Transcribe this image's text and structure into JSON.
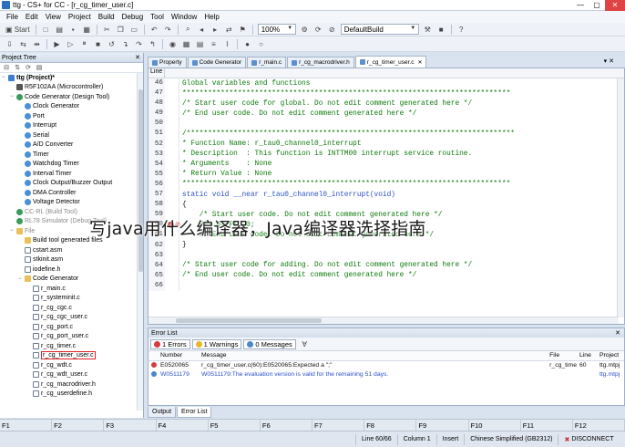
{
  "window": {
    "title": "ttg - CS+ for CC - [r_cg_timer_user.c]"
  },
  "menu": [
    "File",
    "Edit",
    "View",
    "Project",
    "Build",
    "Debug",
    "Tool",
    "Window",
    "Help"
  ],
  "toolbar1": {
    "start_label": "Start",
    "zoom": "100%",
    "build_mode": "DefaultBuild"
  },
  "project_tree": {
    "header": "Project Tree",
    "items": [
      {
        "label": "ttg (Project)*",
        "indent": 0,
        "icon": "proj",
        "exp": "▣",
        "bold": true
      },
      {
        "label": "R5F102AA (Microcontroller)",
        "indent": 1,
        "icon": "chip"
      },
      {
        "label": "Code Generator (Design Tool)",
        "indent": 1,
        "icon": "gear",
        "exp": "▣"
      },
      {
        "label": "Clock Generator",
        "indent": 2,
        "icon": "blue"
      },
      {
        "label": "Port",
        "indent": 2,
        "icon": "blue"
      },
      {
        "label": "Interrupt",
        "indent": 2,
        "icon": "blue"
      },
      {
        "label": "Serial",
        "indent": 2,
        "icon": "blue"
      },
      {
        "label": "A/D Converter",
        "indent": 2,
        "icon": "blue"
      },
      {
        "label": "Timer",
        "indent": 2,
        "icon": "blue"
      },
      {
        "label": "Watchdog Timer",
        "indent": 2,
        "icon": "blue"
      },
      {
        "label": "Interval Timer",
        "indent": 2,
        "icon": "blue"
      },
      {
        "label": "Clock Output/Buzzer Output",
        "indent": 2,
        "icon": "blue"
      },
      {
        "label": "DMA Controller",
        "indent": 2,
        "icon": "blue"
      },
      {
        "label": "Voltage Detector",
        "indent": 2,
        "icon": "blue"
      },
      {
        "label": "CC-RL (Build Tool)",
        "indent": 1,
        "icon": "gear",
        "faded": true
      },
      {
        "label": "RL78 Simulator (Debug Tool)",
        "indent": 1,
        "icon": "gear",
        "faded": true
      },
      {
        "label": "File",
        "indent": 1,
        "icon": "fold",
        "exp": "▣",
        "faded": true
      },
      {
        "label": "Build tool generated files",
        "indent": 2,
        "icon": "fold"
      },
      {
        "label": "cstart.asm",
        "indent": 2,
        "icon": "file"
      },
      {
        "label": "stkinit.asm",
        "indent": 2,
        "icon": "file"
      },
      {
        "label": "iodefine.h",
        "indent": 2,
        "icon": "file"
      },
      {
        "label": "Code Generator",
        "indent": 2,
        "icon": "fold",
        "exp": "▣"
      },
      {
        "label": "r_main.c",
        "indent": 3,
        "icon": "file"
      },
      {
        "label": "r_systeminit.c",
        "indent": 3,
        "icon": "file"
      },
      {
        "label": "r_cg_cgc.c",
        "indent": 3,
        "icon": "file"
      },
      {
        "label": "r_cg_cgc_user.c",
        "indent": 3,
        "icon": "file"
      },
      {
        "label": "r_cg_port.c",
        "indent": 3,
        "icon": "file"
      },
      {
        "label": "r_cg_port_user.c",
        "indent": 3,
        "icon": "file"
      },
      {
        "label": "r_cg_timer.c",
        "indent": 3,
        "icon": "file"
      },
      {
        "label": "r_cg_timer_user.c",
        "indent": 3,
        "icon": "file",
        "selected": true
      },
      {
        "label": "r_cg_wdt.c",
        "indent": 3,
        "icon": "file"
      },
      {
        "label": "r_cg_wdt_user.c",
        "indent": 3,
        "icon": "file"
      },
      {
        "label": "r_cg_macrodriver.h",
        "indent": 3,
        "icon": "file"
      },
      {
        "label": "r_cg_userdefine.h",
        "indent": 3,
        "icon": "file"
      }
    ]
  },
  "editor_tabs": [
    {
      "label": "Property",
      "active": false
    },
    {
      "label": "Code Generator",
      "active": false
    },
    {
      "label": "r_main.c",
      "active": false
    },
    {
      "label": "r_cg_macrodriver.h",
      "active": false
    },
    {
      "label": "r_cg_timer_user.c",
      "active": true
    }
  ],
  "editor": {
    "line_header": "Line",
    "lines": [
      {
        "n": "46",
        "text": "Global variables and functions",
        "kind": "comment"
      },
      {
        "n": "47",
        "text": "*****************************************************************************",
        "kind": "comment"
      },
      {
        "n": "48",
        "text": "/* Start user code for global. Do not edit comment generated here */",
        "kind": "comment"
      },
      {
        "n": "49",
        "text": "/* End user code. Do not edit comment generated here */",
        "kind": "comment"
      },
      {
        "n": "50",
        "text": "",
        "kind": "comment"
      },
      {
        "n": "51",
        "text": "/*****************************************************************************",
        "kind": "comment"
      },
      {
        "n": "52",
        "text": "* Function Name: r_tau0_channel0_interrupt",
        "kind": "comment"
      },
      {
        "n": "53",
        "text": "* Description  : This function is INTTM00 interrupt service routine.",
        "kind": "comment"
      },
      {
        "n": "54",
        "text": "* Arguments    : None",
        "kind": "comment"
      },
      {
        "n": "55",
        "text": "* Return Value : None",
        "kind": "comment"
      },
      {
        "n": "56",
        "text": "*****************************************************************************",
        "kind": "comment"
      },
      {
        "n": "57",
        "text": "static void __near r_tau0_channel0_interrupt(void)",
        "kind": "kw"
      },
      {
        "n": "58",
        "text": "{",
        "kind": "plain"
      },
      {
        "n": "59",
        "text": "    /* Start user code. Do not edit comment generated here */",
        "kind": "comment"
      },
      {
        "n": "60",
        "text": "    P13.0=~P13.0;",
        "kind": "comment",
        "breakpoint": true
      },
      {
        "n": "61",
        "text": "    /* End user code. Do not edit comment generated here */",
        "kind": "comment"
      },
      {
        "n": "62",
        "text": "}",
        "kind": "plain"
      },
      {
        "n": "63",
        "text": "",
        "kind": "plain"
      },
      {
        "n": "64",
        "text": "/* Start user code for adding. Do not edit comment generated here */",
        "kind": "comment"
      },
      {
        "n": "65",
        "text": "/* End user code. Do not edit comment generated here */",
        "kind": "comment"
      },
      {
        "n": "66",
        "text": "",
        "kind": "plain"
      }
    ]
  },
  "watermark": "写java用什么编译器，Java编译器选择指南",
  "error_list": {
    "header": "Error List",
    "filters": {
      "errors": "1 Errors",
      "warnings": "1 Warnings",
      "messages": "0 Messages"
    },
    "columns": [
      "",
      "Number",
      "Message",
      "File",
      "Line",
      "Project"
    ],
    "rows": [
      {
        "type": "error",
        "number": "E0520065",
        "message": "r_cg_timer_user.c(60):E0520065:Expected a \";\"",
        "file": "r_cg_time",
        "line": "60",
        "project": "ttg.mtpj"
      },
      {
        "type": "warning",
        "number": "W0511179",
        "message": "W0511179:The evaluation version is valid for the remaining 51 days.",
        "file": "",
        "line": "",
        "project": "ttg.mtpj"
      }
    ]
  },
  "bottom_tabs": [
    {
      "label": "Output",
      "active": false
    },
    {
      "label": "Error List",
      "active": true
    }
  ],
  "fkeys": [
    "F1",
    "F2",
    "F3",
    "F4",
    "F5",
    "F6",
    "F7",
    "F8",
    "F9",
    "F10",
    "F11",
    "F12"
  ],
  "status": {
    "line": "Line 60/66",
    "column": "Column 1",
    "mode": "Insert",
    "encoding": "Chinese Simplified (GB2312)",
    "connection": "DISCONNECT"
  },
  "colors": {
    "comment": "#0c7a0c",
    "keyword": "#2b4fc9",
    "error": "#d83b3b",
    "accent": "#3c7fd1"
  }
}
